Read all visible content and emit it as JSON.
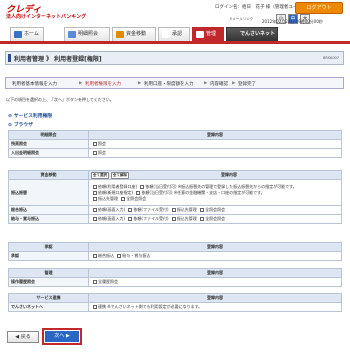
{
  "header": {
    "brand": "クレディ",
    "service": "法人向けインターネットバンキング",
    "user_line": "ログイン名：栢日　花子 様（管理者ユーザ）",
    "logout": "ログアウト",
    "mail_label": "Eメールリンク",
    "font_small": "小",
    "font_large": "大",
    "datetime": "2012年02月24日 09時00分00秒"
  },
  "nav": {
    "tabs": [
      {
        "label": "ホーム",
        "icon": "home-icon",
        "color": "#3a6fc4"
      },
      {
        "label": "明細照会",
        "icon": "document-icon",
        "color": "#5a8bd8"
      },
      {
        "label": "資金移動",
        "icon": "transfer-icon",
        "color": "#e08a00"
      },
      {
        "label": "承認",
        "icon": "stamp-icon",
        "color": "#3a9d4f"
      },
      {
        "label": "管理",
        "icon": "gear-icon",
        "color": "#ffffff"
      },
      {
        "label": "でんさいネット",
        "icon": "net-icon",
        "color": "#ffffff"
      }
    ]
  },
  "page": {
    "title": "利用者管理 》 利用者登録[権限]",
    "code": "BRSK007",
    "steps": [
      "利用者基本情報を入力",
      "利用者権限を入力",
      "利用口座・限度額を入力",
      "内容確認",
      "登録完了"
    ],
    "guide": "以下の項目を選択の上、「次へ」ボタンを押してください。",
    "section1": "サービス利用権限",
    "section2": "ブラウザ"
  },
  "tables": {
    "col_header": "登録内容",
    "inquiry": {
      "header": "明細照会",
      "rows": [
        {
          "label": "残高照会",
          "opts": [
            "照会"
          ]
        },
        {
          "label": "入出金明細照会",
          "opts": [
            "照会"
          ]
        }
      ]
    },
    "transfer": {
      "header": "資金移動",
      "badges": [
        "全て選択",
        "全て解除"
      ],
      "rows": [
        {
          "label": "振込振替",
          "lines": [
            [
              "依頼(利用者登録口座)",
              "依頼(当日受付可)",
              "※振込振替先の管理で登録した振込振替先からの指定が可能です。"
            ],
            [
              "依頼(新規口座指定)",
              "依頼(当日受付可)",
              "※任意の金融機関・支店・口座の指定が可能です。"
            ],
            [
              "振込先管理",
              "全照会照会"
            ]
          ]
        },
        {
          "label": "総合振込",
          "lines": [
            [
              "依頼(画面入力)",
              "依頼(ファイル受付)",
              "振込先管理",
              "全照会照会"
            ]
          ]
        },
        {
          "label": "給与・賞与振込",
          "lines": [
            [
              "依頼(画面入力)",
              "依頼(ファイル受付)",
              "振込先管理",
              "全照会照会"
            ]
          ]
        }
      ]
    },
    "approval": {
      "header": "承認",
      "rows": [
        {
          "label": "承認",
          "opts": [
            "総合振込",
            "給与・賞与振込"
          ]
        }
      ]
    },
    "admin": {
      "header": "管理",
      "rows": [
        {
          "label": "操作履歴照会",
          "opts": [
            "全履歴照会"
          ]
        }
      ]
    },
    "service": {
      "header": "サービス連携",
      "rows": [
        {
          "label": "でんさいネットへ",
          "opts": [
            "連携"
          ],
          "note": "※でんさいネット側でも利用設定が必要になります。"
        }
      ]
    }
  },
  "buttons": {
    "back": "◀ 戻る",
    "next": "次へ ▶"
  }
}
